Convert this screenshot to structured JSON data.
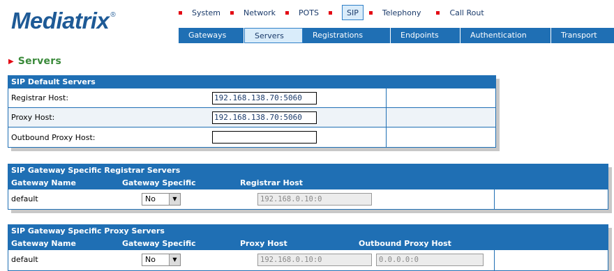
{
  "brand": {
    "name": "Mediatrix",
    "reg": "®"
  },
  "topnav": [
    {
      "label": "System",
      "active": false
    },
    {
      "label": "Network",
      "active": false
    },
    {
      "label": "POTS",
      "active": false
    },
    {
      "label": "SIP",
      "active": true
    },
    {
      "label": "Telephony",
      "active": false
    },
    {
      "label": "Call Rout",
      "active": false
    }
  ],
  "subnav": [
    {
      "label": "Gateways",
      "active": false
    },
    {
      "label": "Servers",
      "active": true
    },
    {
      "label": "Registrations",
      "active": false
    },
    {
      "label": "Endpoints",
      "active": false
    },
    {
      "label": "Authentication",
      "active": false
    },
    {
      "label": "Transport",
      "active": false
    }
  ],
  "page": {
    "title": "Servers"
  },
  "default_servers": {
    "title": "SIP Default Servers",
    "registrar_label": "Registrar Host:",
    "registrar_value": "192.168.138.70:5060",
    "proxy_label": "Proxy Host:",
    "proxy_value": "192.168.138.70:5060",
    "outbound_label": "Outbound Proxy Host:",
    "outbound_value": ""
  },
  "registrar_servers": {
    "title": "SIP Gateway Specific Registrar Servers",
    "col_name": "Gateway Name",
    "col_specific": "Gateway Specific",
    "col_host": "Registrar Host",
    "row": {
      "name": "default",
      "specific": "No",
      "host": "192.168.0.10:0"
    }
  },
  "proxy_servers": {
    "title": "SIP Gateway Specific Proxy Servers",
    "col_name": "Gateway Name",
    "col_specific": "Gateway Specific",
    "col_host": "Proxy Host",
    "col_outbound": "Outbound Proxy Host",
    "row": {
      "name": "default",
      "specific": "No",
      "host": "192.168.0.10:0",
      "outbound": "0.0.0.0:0"
    }
  },
  "colors": {
    "brand": "#1e5a96",
    "header": "#1f6fb4",
    "accent_red": "#e30613",
    "title_green": "#3a8a3a"
  }
}
